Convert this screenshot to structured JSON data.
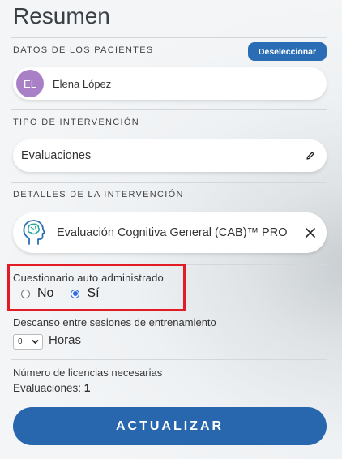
{
  "page_title": "Resumen",
  "patients": {
    "section_label": "DATOS DE LOS PACIENTES",
    "deselect_label": "Deseleccionar",
    "selected": {
      "initials": "EL",
      "name": "Elena López",
      "avatar_color": "#a980c6"
    }
  },
  "intervention_type": {
    "section_label": "TIPO DE INTERVENCIÓN",
    "value": "Evaluaciones"
  },
  "intervention_details": {
    "section_label": "DETALLES DE LA INTERVENCIÓN",
    "assessment": "Evaluación Cognitiva General (CAB)™ PRO",
    "icon": "head-brain-icon"
  },
  "self_administered": {
    "label": "Cuestionario auto administrado",
    "options": [
      {
        "label": "No",
        "selected": false
      },
      {
        "label": "Sí",
        "selected": true
      }
    ]
  },
  "rest_between_sessions": {
    "label": "Descanso entre sesiones de entrenamiento",
    "value": "0",
    "unit": "Horas"
  },
  "licenses": {
    "label": "Número de licencias necesarias",
    "item_label": "Evaluaciones:",
    "count": "1"
  },
  "update_button": "ACTUALIZAR",
  "colors": {
    "primary": "#2b6db4",
    "highlight": "#e21c24",
    "radio": "#2b6de0"
  }
}
